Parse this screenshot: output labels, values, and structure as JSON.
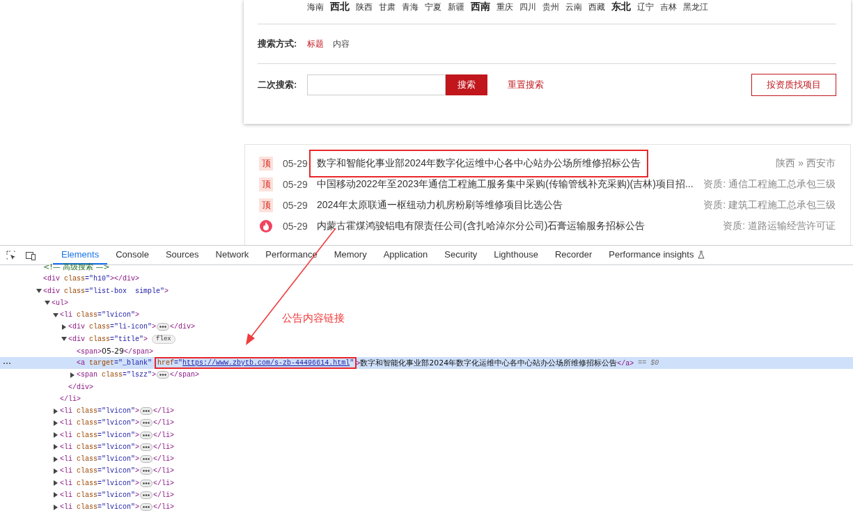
{
  "search_panel": {
    "regions": [
      {
        "label": "海南",
        "bold": false
      },
      {
        "label": "西北",
        "bold": true
      },
      {
        "label": "陕西",
        "bold": false
      },
      {
        "label": "甘肃",
        "bold": false
      },
      {
        "label": "青海",
        "bold": false
      },
      {
        "label": "宁夏",
        "bold": false
      },
      {
        "label": "新疆",
        "bold": false
      },
      {
        "label": "西南",
        "bold": true
      },
      {
        "label": "重庆",
        "bold": false
      },
      {
        "label": "四川",
        "bold": false
      },
      {
        "label": "贵州",
        "bold": false
      },
      {
        "label": "云南",
        "bold": false
      },
      {
        "label": "西藏",
        "bold": false
      },
      {
        "label": "东北",
        "bold": true
      },
      {
        "label": "辽宁",
        "bold": false
      },
      {
        "label": "吉林",
        "bold": false
      },
      {
        "label": "黑龙江",
        "bold": false
      }
    ],
    "mode_label": "搜索方式:",
    "mode_options": [
      {
        "label": "标题",
        "selected": true
      },
      {
        "label": "内容",
        "selected": false
      }
    ],
    "second_search_label": "二次搜索:",
    "search_button": "搜索",
    "reset_link": "重置搜索",
    "qualification_button": "按资质找项目"
  },
  "listings": [
    {
      "kind": "top",
      "badge": "顶",
      "date": "05-29",
      "title": "数字和智能化事业部2024年数字化运维中心各中心站办公场所维修招标公告",
      "meta": "陕西 » 西安市",
      "highlighted": true
    },
    {
      "kind": "top",
      "badge": "顶",
      "date": "05-29",
      "title": "中国移动2022年至2023年通信工程施工服务集中采购(传输管线补充采购)(吉林)项目招...",
      "meta": "资质: 通信工程施工总承包三级",
      "highlighted": false
    },
    {
      "kind": "top",
      "badge": "顶",
      "date": "05-29",
      "title": "2024年太原联通一枢纽动力机房粉刷等维修项目比选公告",
      "meta": "资质: 建筑工程施工总承包三级",
      "highlighted": false
    },
    {
      "kind": "hot",
      "date": "05-29",
      "title": "内蒙古霍煤鸿骏铝电有限责任公司(含扎哈淖尔分公司)石膏运输服务招标公告",
      "meta": "资质: 道路运输经营许可证",
      "highlighted": false
    }
  ],
  "devtools": {
    "tabs": [
      {
        "label": "Elements",
        "kind": "plain",
        "selected": true
      },
      {
        "label": "Console",
        "kind": "plain",
        "selected": false
      },
      {
        "label": "Sources",
        "kind": "plain",
        "selected": false
      },
      {
        "label": "Network",
        "kind": "plain",
        "selected": false
      },
      {
        "label": "Performance",
        "kind": "plain",
        "selected": false
      },
      {
        "label": "Memory",
        "kind": "plain",
        "selected": false
      },
      {
        "label": "Application",
        "kind": "plain",
        "selected": false
      },
      {
        "label": "Security",
        "kind": "plain",
        "selected": false
      },
      {
        "label": "Lighthouse",
        "kind": "plain",
        "selected": false
      },
      {
        "label": "Recorder",
        "kind": "plain",
        "selected": false
      },
      {
        "label": "Performance insights",
        "kind": "experimental",
        "selected": false
      }
    ],
    "tree": [
      {
        "kind": "comment",
        "text": "<!— 高级搜索 —>",
        "selected": false
      },
      {
        "kind": "element",
        "open": "<div",
        "attrs": [
          {
            "name": "class",
            "value": "=\"h10\"",
            "highlighted": false
          }
        ],
        "end": ">",
        "close": "</div>",
        "selected": false
      },
      {
        "kind": "element",
        "open": "<div",
        "attrs": [
          {
            "name": "class",
            "value": "=\"list-box  simple\"",
            "highlighted": false
          }
        ],
        "end": ">",
        "expanded": true,
        "selected": false,
        "children": [
          {
            "kind": "element",
            "open": "<ul",
            "end": ">",
            "expanded": true,
            "selected": false,
            "children": [
              {
                "kind": "element",
                "open": "<li",
                "attrs": [
                  {
                    "name": "class",
                    "value": "=\"lvicon\"",
                    "highlighted": false
                  }
                ],
                "end": ">",
                "expanded": true,
                "close": "</li>",
                "selected": false,
                "children": [
                  {
                    "kind": "element",
                    "open": "<div",
                    "attrs": [
                      {
                        "name": "class",
                        "value": "=\"li-icon\"",
                        "highlighted": false
                      }
                    ],
                    "end": ">",
                    "expanded": false,
                    "close": "</div>",
                    "selected": false
                  },
                  {
                    "kind": "element",
                    "open": "<div",
                    "attrs": [
                      {
                        "name": "class",
                        "value": "=\"title\"",
                        "highlighted": false
                      }
                    ],
                    "end": ">",
                    "badge": "flex",
                    "expanded": true,
                    "close": "</div>",
                    "selected": false,
                    "children": [
                      {
                        "kind": "element",
                        "open": "<span",
                        "end": ">",
                        "text": "05-29",
                        "close": "</span>",
                        "selected": false
                      },
                      {
                        "kind": "element",
                        "open": "<a",
                        "attrs": [
                          {
                            "name": "target",
                            "value": "=\"_blank\"",
                            "highlighted": false
                          },
                          {
                            "name": "href",
                            "kind": "link",
                            "before": "=\"",
                            "value": "https://www.zbytb.com/s-zb-44496614.html",
                            "after": "\"",
                            "highlighted": true
                          }
                        ],
                        "end": ">",
                        "text": "数字和智能化事业部2024年数字化运维中心各中心站办公场所维修招标公告",
                        "close": "</a>",
                        "selected": true,
                        "reference": "== $0"
                      },
                      {
                        "kind": "element",
                        "open": "<span",
                        "attrs": [
                          {
                            "name": "class",
                            "value": "=\"lszz\"",
                            "highlighted": false
                          }
                        ],
                        "end": ">",
                        "expanded": false,
                        "close": "</span>",
                        "selected": false
                      }
                    ]
                  }
                ]
              },
              {
                "kind": "element",
                "open": "<li",
                "attrs": [
                  {
                    "name": "class",
                    "value": "=\"lvicon\"",
                    "highlighted": false
                  }
                ],
                "end": ">",
                "expanded": false,
                "close": "</li>",
                "selected": false
              },
              {
                "kind": "element",
                "open": "<li",
                "attrs": [
                  {
                    "name": "class",
                    "value": "=\"lvicon\"",
                    "highlighted": false
                  }
                ],
                "end": ">",
                "expanded": false,
                "close": "</li>",
                "selected": false
              },
              {
                "kind": "element",
                "open": "<li",
                "attrs": [
                  {
                    "name": "class",
                    "value": "=\"lvicon\"",
                    "highlighted": false
                  }
                ],
                "end": ">",
                "expanded": false,
                "close": "</li>",
                "selected": false
              },
              {
                "kind": "element",
                "open": "<li",
                "attrs": [
                  {
                    "name": "class",
                    "value": "=\"lvicon\"",
                    "highlighted": false
                  }
                ],
                "end": ">",
                "expanded": false,
                "close": "</li>",
                "selected": false
              },
              {
                "kind": "element",
                "open": "<li",
                "attrs": [
                  {
                    "name": "class",
                    "value": "=\"lvicon\"",
                    "highlighted": false
                  }
                ],
                "end": ">",
                "expanded": false,
                "close": "</li>",
                "selected": false
              },
              {
                "kind": "element",
                "open": "<li",
                "attrs": [
                  {
                    "name": "class",
                    "value": "=\"lvicon\"",
                    "highlighted": false
                  }
                ],
                "end": ">",
                "expanded": false,
                "close": "</li>",
                "selected": false
              },
              {
                "kind": "element",
                "open": "<li",
                "attrs": [
                  {
                    "name": "class",
                    "value": "=\"lvicon\"",
                    "highlighted": false
                  }
                ],
                "end": ">",
                "expanded": false,
                "close": "</li>",
                "selected": false
              },
              {
                "kind": "element",
                "open": "<li",
                "attrs": [
                  {
                    "name": "class",
                    "value": "=\"lvicon\"",
                    "highlighted": false
                  }
                ],
                "end": ">",
                "expanded": false,
                "close": "</li>",
                "selected": false
              },
              {
                "kind": "element",
                "open": "<li",
                "attrs": [
                  {
                    "name": "class",
                    "value": "=\"lvicon\"",
                    "highlighted": false
                  }
                ],
                "end": ">",
                "expanded": false,
                "close": "</li>",
                "selected": false
              }
            ]
          }
        ]
      }
    ]
  },
  "annotation": {
    "label": "公告内容链接"
  }
}
